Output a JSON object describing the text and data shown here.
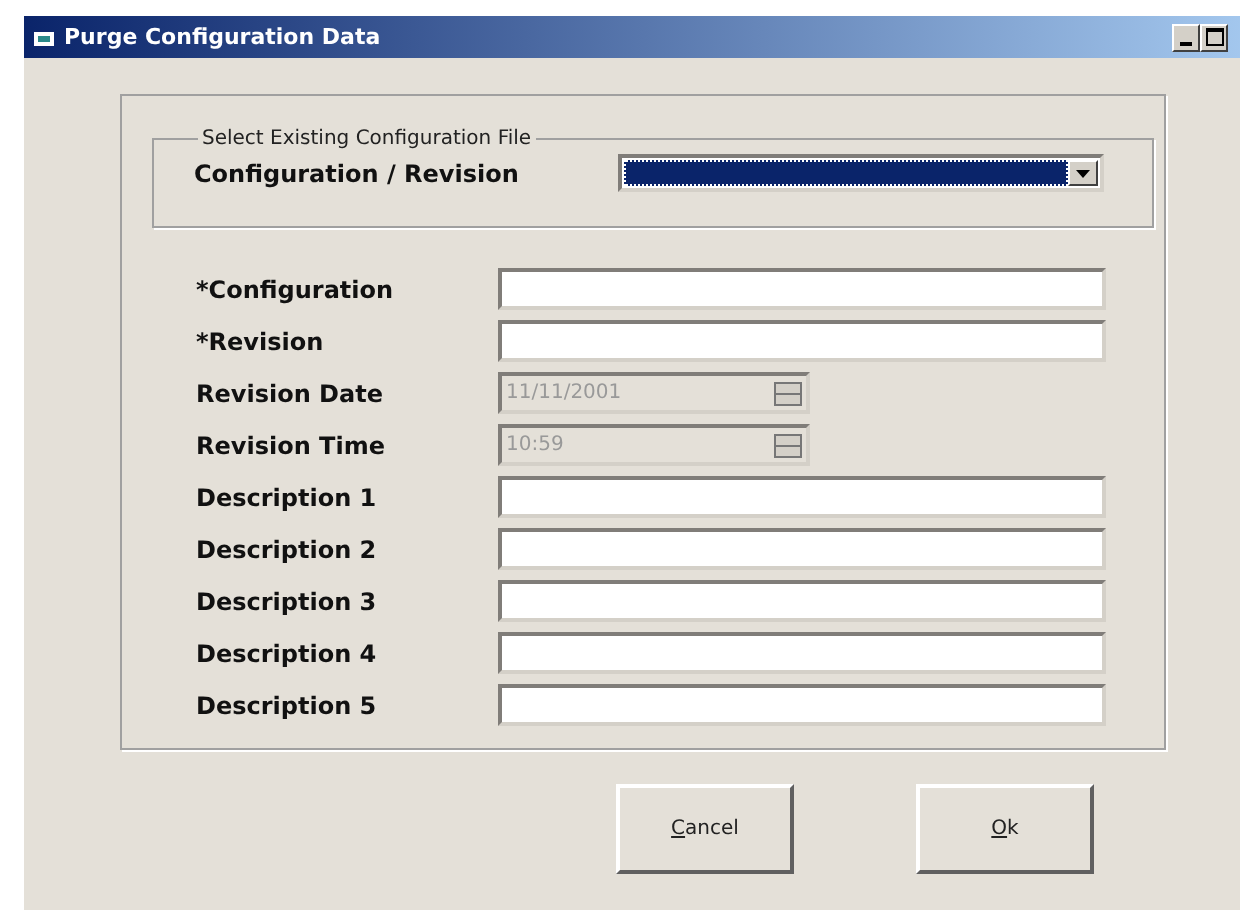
{
  "window": {
    "title": "Purge Configuration Data"
  },
  "select_group": {
    "legend": "Select Existing Configuration File",
    "label": "Configuration / Revision",
    "combo": {
      "selected": true
    }
  },
  "fields": [
    {
      "label": "*Configuration",
      "kind": "text",
      "disabled": false
    },
    {
      "label": "*Revision",
      "kind": "text",
      "disabled": false
    },
    {
      "label": "Revision Date",
      "kind": "spin",
      "disabled": true,
      "value": "11/11/2001"
    },
    {
      "label": "Revision Time",
      "kind": "spin",
      "disabled": true,
      "value": "10:59"
    },
    {
      "label": "Description 1",
      "kind": "text",
      "disabled": false
    },
    {
      "label": "Description 2",
      "kind": "text",
      "disabled": false
    },
    {
      "label": "Description 3",
      "kind": "text",
      "disabled": false
    },
    {
      "label": "Description 4",
      "kind": "text",
      "disabled": false
    },
    {
      "label": "Description 5",
      "kind": "text",
      "disabled": false
    }
  ],
  "buttons": [
    {
      "label": "Cancel"
    },
    {
      "label": "Ok"
    }
  ]
}
